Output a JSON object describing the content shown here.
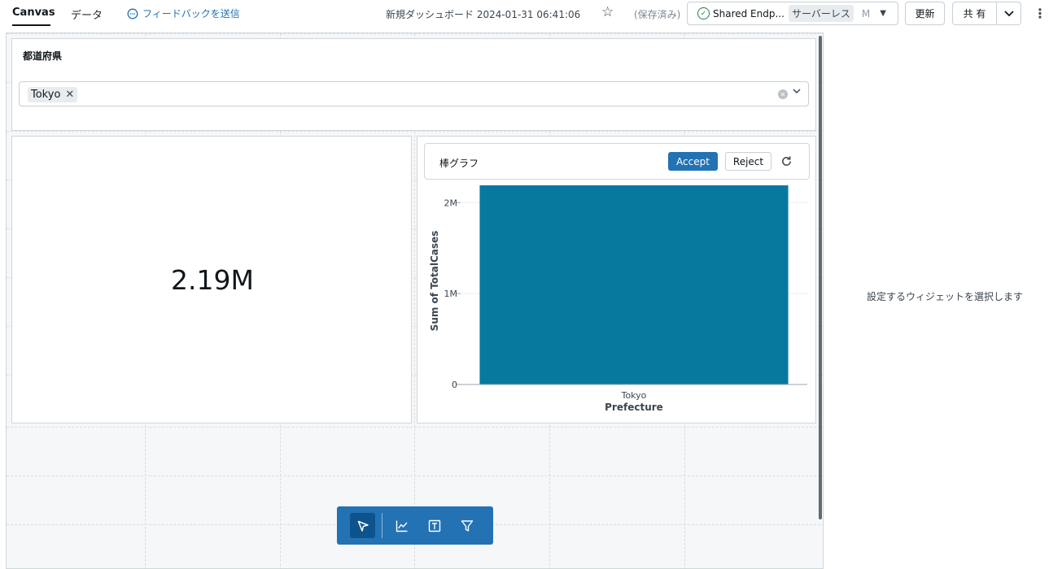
{
  "header": {
    "tabs": [
      {
        "label": "Canvas"
      },
      {
        "label": "データ"
      }
    ],
    "feedback_label": "フィードバックを送信",
    "dashboard_title": "新規ダッシュボード 2024-01-31 06:41:06",
    "saved_status": "(保存済み)",
    "endpoint": {
      "name": "Shared Endp...",
      "type": "サーバーレス",
      "size": "M"
    },
    "refresh_label": "更新",
    "share_label": "共 有"
  },
  "filter_widget": {
    "title": "都道府県",
    "selected": [
      {
        "label": "Tokyo"
      }
    ]
  },
  "counter_widget": {
    "value": "2.19M"
  },
  "chart_widget": {
    "header_title": "棒グラフ",
    "accept_label": "Accept",
    "reject_label": "Reject"
  },
  "chart_data": {
    "type": "bar",
    "categories": [
      "Tokyo"
    ],
    "values": [
      2190000
    ],
    "ylim": [
      0,
      2190000
    ],
    "yticks": [
      {
        "value": 0,
        "label": "0"
      },
      {
        "value": 1000000,
        "label": "1M"
      },
      {
        "value": 2000000,
        "label": "2M"
      }
    ],
    "xlabel": "Prefecture",
    "ylabel": "Sum of TotalCases",
    "bar_color": "#08799e",
    "grid": true
  },
  "right_panel": {
    "placeholder": "設定するウィジェットを選択します"
  },
  "colors": {
    "accent": "#2272b4",
    "toolbar_active": "#0e538b",
    "success": "#277c43"
  }
}
